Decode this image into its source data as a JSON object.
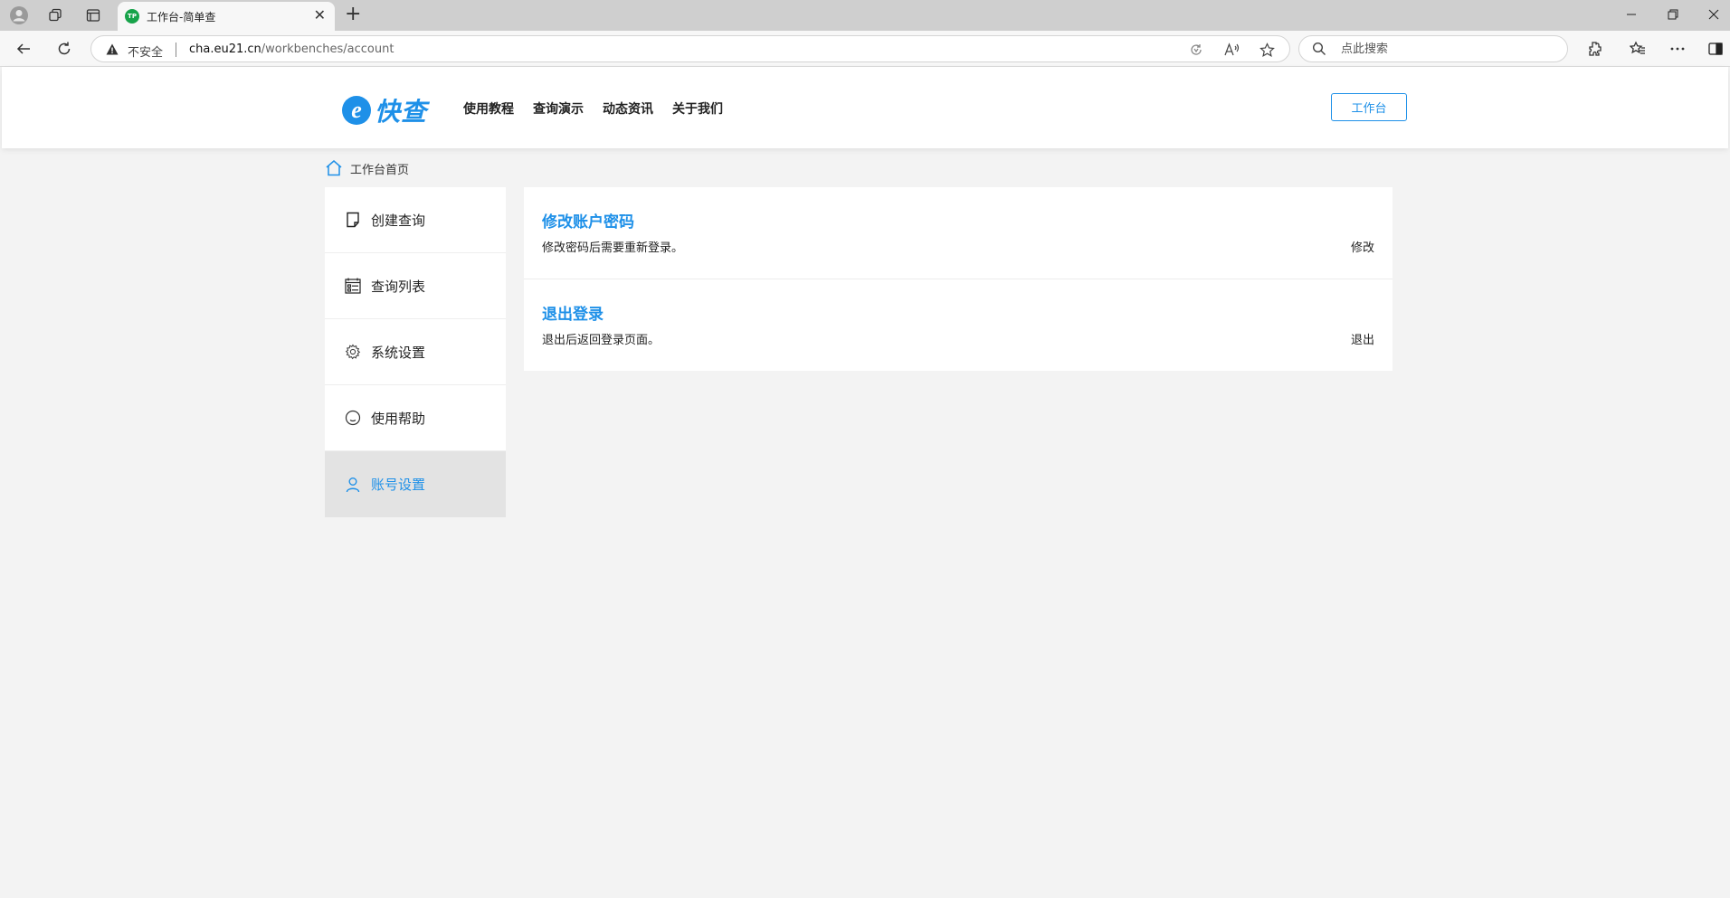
{
  "browser": {
    "tab_title": "工作台-简单查",
    "tab_favicon_text": "TP",
    "insecure_label": "不安全",
    "url_host": "cha.eu21.cn",
    "url_path": "/workbenches/account",
    "search_placeholder": "点此搜索",
    "new_tab_symbol": "+",
    "tab_close_symbol": "✕"
  },
  "header": {
    "logo_letter": "e",
    "logo_text": "快查",
    "nav": [
      "使用教程",
      "查询演示",
      "动态资讯",
      "关于我们"
    ],
    "workbench_button": "工作台"
  },
  "breadcrumb": {
    "label": "工作台首页"
  },
  "sidebar": {
    "items": [
      {
        "label": "创建查询",
        "icon": "document-icon"
      },
      {
        "label": "查询列表",
        "icon": "list-icon"
      },
      {
        "label": "系统设置",
        "icon": "gear-icon"
      },
      {
        "label": "使用帮助",
        "icon": "smile-icon"
      },
      {
        "label": "账号设置",
        "icon": "user-icon",
        "active": true
      }
    ]
  },
  "account": {
    "rows": [
      {
        "title": "修改账户密码",
        "desc": "修改密码后需要重新登录。",
        "action": "修改"
      },
      {
        "title": "退出登录",
        "desc": "退出后返回登录页面。",
        "action": "退出"
      }
    ]
  },
  "colors": {
    "accent": "#1e90e8",
    "page_bg": "#f3f3f3",
    "active_sidebar_bg": "#e3e3e3"
  }
}
